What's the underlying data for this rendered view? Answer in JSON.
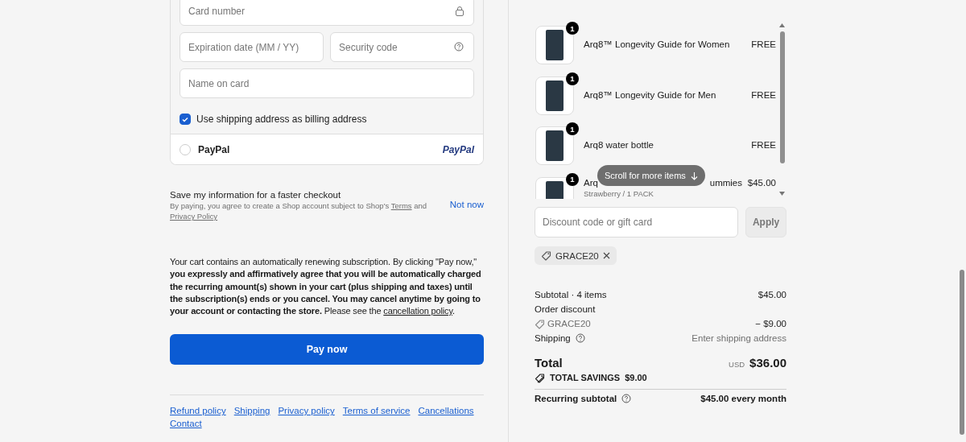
{
  "payment_form": {
    "card_number": {
      "placeholder": "Card number"
    },
    "expiration": {
      "placeholder": "Expiration date (MM / YY)"
    },
    "security_code": {
      "placeholder": "Security code"
    },
    "name_on_card": {
      "placeholder": "Name on card"
    },
    "billing_same": {
      "label": "Use shipping address as billing address",
      "checked": true
    }
  },
  "paypal": {
    "label": "PayPal",
    "selected": false,
    "logo": "PayPal"
  },
  "save_info": {
    "title": "Save my information for a faster checkout",
    "consent": [
      {
        "kind": "plain",
        "text": "By paying, you agree to create a Shop account subject to Shop's "
      },
      {
        "kind": "link",
        "text": "Terms"
      },
      {
        "kind": "plain",
        "text": " and "
      },
      {
        "kind": "link",
        "text": "Privacy Policy"
      }
    ],
    "not_now": "Not now"
  },
  "subscription_notice": [
    {
      "kind": "plain",
      "text": "Your cart contains an automatically renewing subscription. By clicking \"Pay now,\" "
    },
    {
      "kind": "bold",
      "text": "you expressly and affirmatively agree that you will be automatically charged the recurring amount(s) shown in your cart (plus shipping and taxes) until the subscription(s) ends or you cancel. You may cancel anytime by going to your account or contacting the store."
    },
    {
      "kind": "plain",
      "text": " Please see the "
    },
    {
      "kind": "link",
      "text": "cancellation policy"
    },
    {
      "kind": "plain",
      "text": "."
    }
  ],
  "pay_button": "Pay now",
  "footer_links": [
    "Refund policy",
    "Shipping",
    "Privacy policy",
    "Terms of service",
    "Cancellations",
    "Contact"
  ],
  "cart_items": [
    {
      "name": "Arq8™ Longevity Guide for Women",
      "quantity": "1",
      "price": "FREE"
    },
    {
      "name": "Arq8™ Longevity Guide for Men",
      "quantity": "1",
      "price": "FREE"
    },
    {
      "name": "Arq8 water bottle",
      "quantity": "1",
      "price": "FREE"
    },
    {
      "name_start": "Arq",
      "name_end": "ummies",
      "variant": "Strawberry / 1 PACK",
      "quantity": "1",
      "price": "$45.00"
    }
  ],
  "scroll_hint": "Scroll for more items",
  "discount": {
    "placeholder": "Discount code or gift card",
    "apply": "Apply",
    "disabled": true
  },
  "applied_codes": [
    {
      "code": "GRACE20"
    }
  ],
  "summary": {
    "subtotal_label": "Subtotal · 4 items",
    "subtotal": "$45.00",
    "order_discount_label": "Order discount",
    "discount_code": "GRACE20",
    "discount_amount": "− $9.00",
    "shipping_label": "Shipping",
    "shipping_value": "Enter shipping address",
    "total_label": "Total",
    "currency": "USD",
    "total": "$36.00",
    "savings_label": "TOTAL SAVINGS",
    "savings": "$9.00",
    "recurring_label": "Recurring subtotal",
    "recurring_value": "$45.00 every month"
  }
}
